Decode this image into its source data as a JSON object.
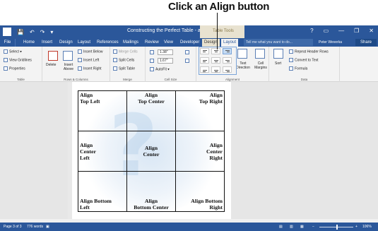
{
  "callout": {
    "text": "Click an Align button"
  },
  "titlebar": {
    "title": "Constructing the Perfect Table - a4 - Word",
    "context_group": "Table Tools",
    "controls": [
      "?",
      "▭",
      "—",
      "❐",
      "✕"
    ]
  },
  "tabs": {
    "file": "File",
    "items": [
      "Home",
      "Insert",
      "Design",
      "Layout",
      "References",
      "Mailings",
      "Review",
      "View",
      "Developer"
    ],
    "ctx_design": "Design",
    "ctx_layout": "Layout",
    "tellme": "Tell me what you want to do...",
    "user": "Peter Weverka",
    "share": "Share"
  },
  "ribbon": {
    "table": {
      "select": "Select ▾",
      "gridlines": "View Gridlines",
      "properties": "Properties",
      "label": "Table"
    },
    "rowscols": {
      "delete": "Delete",
      "insert_above": "Insert Above",
      "below": "Insert Below",
      "left": "Insert Left",
      "right": "Insert Right",
      "label": "Rows & Columns"
    },
    "merge": {
      "merge": "Merge Cells",
      "split": "Split Cells",
      "split_table": "Split Table",
      "label": "Merge"
    },
    "cellsize": {
      "height": "1.38\"",
      "width": "1.67\"",
      "autofit": "AutoFit ▾",
      "label": "Cell Size"
    },
    "alignment": {
      "direction": "Text Direction",
      "margins": "Cell Margins",
      "label": "Alignment"
    },
    "data": {
      "sort": "Sort",
      "repeat": "Repeat Header Rows",
      "convert": "Convert to Text",
      "formula": "Formula",
      "label": "Data"
    }
  },
  "table": {
    "rows": [
      [
        "Align\nTop Left",
        "Align\nTop Center",
        "Align\nTop Right"
      ],
      [
        "Align\nCenter\nLeft",
        "Align\nCenter",
        "Align\nCenter\nRight"
      ],
      [
        "Align Bottom\nLeft",
        "Align\nBottom Center",
        "Align Bottom\nRight"
      ]
    ]
  },
  "status": {
    "page": "Page 3 of 3",
    "words": "776 words",
    "zoom": "106%"
  }
}
